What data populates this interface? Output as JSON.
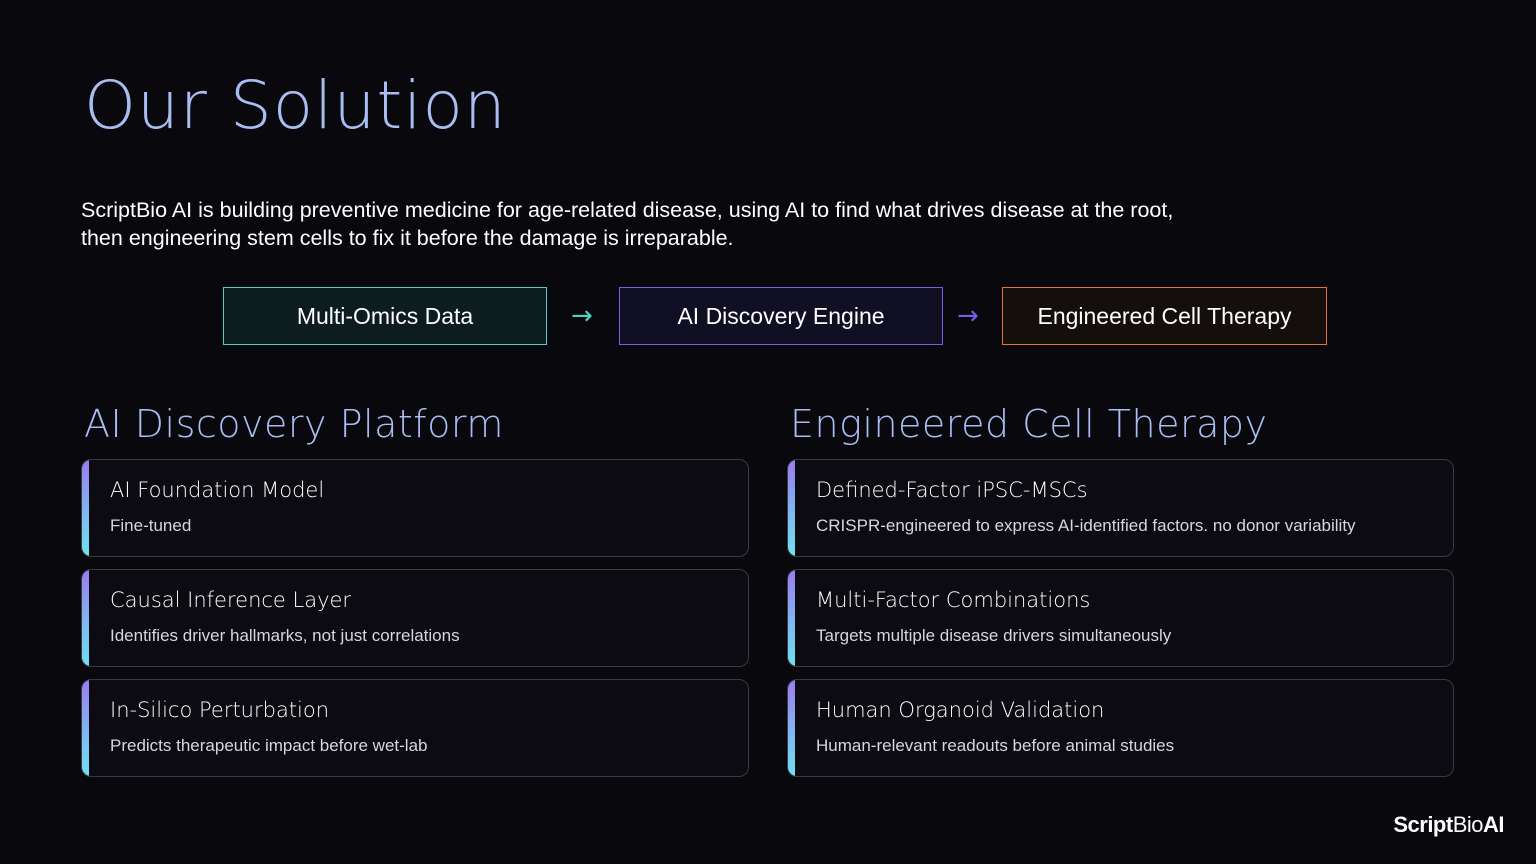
{
  "slide": {
    "title": "Our Solution",
    "intro_line1": "ScriptBio AI is building preventive medicine for age-related disease, using AI to find what drives disease at the root,",
    "intro_line2": "then engineering stem cells to fix it before the damage is irreparable."
  },
  "flow": {
    "steps": [
      "Multi-Omics Data",
      "AI Discovery Engine",
      "Engineered Cell Therapy"
    ],
    "arrow": "→",
    "colors": [
      "#4fd1c5",
      "#7b5ce6",
      "#e8713a"
    ]
  },
  "left_section": {
    "title": "AI Discovery Platform",
    "cards": [
      {
        "title": "AI Foundation Model",
        "desc": "Fine-tuned"
      },
      {
        "title": "Causal Inference Layer",
        "desc": "Identifies driver hallmarks, not just correlations"
      },
      {
        "title": "In-Silico Perturbation",
        "desc": "Predicts therapeutic impact before wet-lab"
      }
    ]
  },
  "right_section": {
    "title": "Engineered Cell Therapy",
    "cards": [
      {
        "title": "Defined-Factor iPSC-MSCs",
        "desc": "CRISPR-engineered to express AI-identified factors. no donor variability"
      },
      {
        "title": "Multi-Factor Combinations",
        "desc": "Targets multiple disease drivers simultaneously"
      },
      {
        "title": "Human Organoid Validation",
        "desc": "Human-relevant readouts before animal studies"
      }
    ]
  },
  "logo": {
    "part1": "Script",
    "part2": "Bio",
    "part3": "AI"
  },
  "theme": {
    "background": "#08080d",
    "title_color": "#a9bdf2",
    "accent_teal": "#4fd1c5",
    "accent_purple": "#7b5ce6",
    "accent_orange": "#e8713a"
  }
}
